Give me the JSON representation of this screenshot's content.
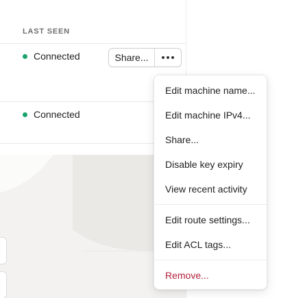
{
  "table": {
    "column_header": "LAST SEEN",
    "rows": [
      {
        "status": "Connected",
        "status_color": "#1aa36b",
        "share_label": "Share..."
      },
      {
        "status": "Connected",
        "status_color": "#1aa36b"
      }
    ]
  },
  "menu": {
    "items": [
      "Edit machine name...",
      "Edit machine IPv4...",
      "Share...",
      "Disable key expiry",
      "View recent activity",
      "Edit route settings...",
      "Edit ACL tags...",
      "Remove..."
    ],
    "danger_color": "#b3203b"
  }
}
